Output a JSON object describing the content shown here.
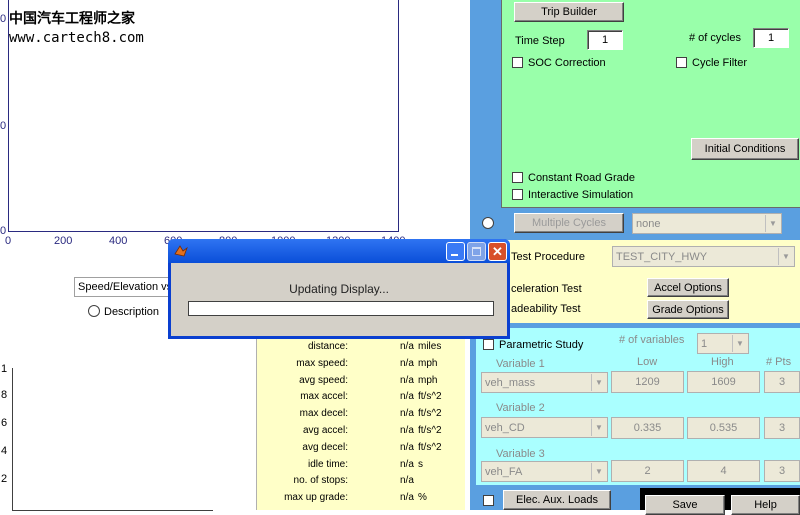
{
  "watermark": {
    "line1": "中国汽车工程师之家",
    "line2": "www.cartech8.com"
  },
  "top_plot": {
    "x_ticks": [
      "0",
      "200",
      "400",
      "600",
      "800",
      "1000",
      "1200",
      "1400"
    ],
    "y_ticks": [
      "0",
      "0",
      "0"
    ]
  },
  "plot_selector": {
    "value": "Speed/Elevation vs.",
    "radio_label": "Description"
  },
  "bottom_plot": {
    "y_ticks": [
      "1",
      "8",
      "6",
      "4",
      "2"
    ]
  },
  "stats": [
    {
      "name": "distance:",
      "value": "n/a",
      "unit": "miles"
    },
    {
      "name": "max speed:",
      "value": "n/a",
      "unit": "mph"
    },
    {
      "name": "avg speed:",
      "value": "n/a",
      "unit": "mph"
    },
    {
      "name": "max accel:",
      "value": "n/a",
      "unit": "ft/s^2"
    },
    {
      "name": "max decel:",
      "value": "n/a",
      "unit": "ft/s^2"
    },
    {
      "name": "avg accel:",
      "value": "n/a",
      "unit": "ft/s^2"
    },
    {
      "name": "avg decel:",
      "value": "n/a",
      "unit": "ft/s^2"
    },
    {
      "name": "idle time:",
      "value": "n/a",
      "unit": "s"
    },
    {
      "name": "no. of stops:",
      "value": "n/a",
      "unit": ""
    },
    {
      "name": "max up grade:",
      "value": "n/a",
      "unit": "%"
    }
  ],
  "green_panel": {
    "trip_builder": "Trip Builder",
    "time_step_label": "Time Step",
    "time_step_value": "1",
    "cycles_label": "# of cycles",
    "cycles_value": "1",
    "soc_correction": "SOC Correction",
    "cycle_filter": "Cycle Filter",
    "initial_conditions": "Initial Conditions",
    "constant_road_grade": "Constant Road Grade",
    "interactive_simulation": "Interactive Simulation"
  },
  "multiple_cycles": {
    "button": "Multiple Cycles",
    "select": "none"
  },
  "test_panel": {
    "test_procedure_label": "Test Procedure",
    "test_procedure_value": "TEST_CITY_HWY",
    "accel_test": "celeration Test",
    "accel_options": "Accel Options",
    "grade_test": "adeability Test",
    "grade_options": "Grade Options"
  },
  "parametric": {
    "label": "Parametric Study",
    "num_vars_label": "# of variables",
    "num_vars_value": "1",
    "col_low": "Low",
    "col_high": "High",
    "col_pts": "# Pts",
    "variables": [
      {
        "title": "Variable 1",
        "name": "veh_mass",
        "low": "1209",
        "high": "1609",
        "pts": "3"
      },
      {
        "title": "Variable 2",
        "name": "veh_CD",
        "low": "0.335",
        "high": "0.535",
        "pts": "3"
      },
      {
        "title": "Variable 3",
        "name": "veh_FA",
        "low": "2",
        "high": "4",
        "pts": "3"
      }
    ]
  },
  "bottom_buttons": {
    "elec_aux": "Elec. Aux. Loads",
    "save": "Save",
    "help": "Help"
  },
  "dialog": {
    "message": "Updating Display...",
    "progress": 0
  }
}
